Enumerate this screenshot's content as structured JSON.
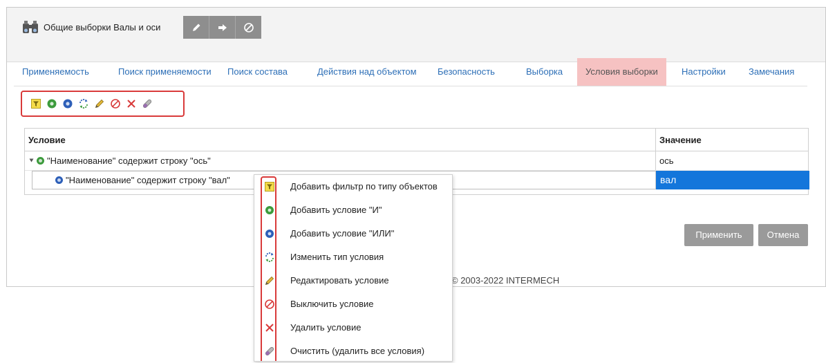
{
  "header": {
    "title": "Общие выборки Валы и оси",
    "title_icon": "binoculars-icon",
    "tools": [
      "pencil-icon",
      "arrow-right-icon",
      "cancel-icon"
    ]
  },
  "tabs": [
    {
      "label": "Применяемость"
    },
    {
      "label": "Поиск применяемости"
    },
    {
      "label": "Поиск состава"
    },
    {
      "label": "Действия над объектом"
    },
    {
      "label": "Безопасность"
    },
    {
      "label": "Выборка"
    },
    {
      "label": "Условия выборки",
      "active": true
    },
    {
      "label": "Настройки"
    },
    {
      "label": "Замечания"
    }
  ],
  "toolbar": {
    "icons": [
      "type-filter-icon",
      "and-condition-icon",
      "or-condition-icon",
      "change-type-icon",
      "edit-icon",
      "disable-icon",
      "delete-icon",
      "clear-icon"
    ]
  },
  "grid": {
    "columns": {
      "condition": "Условие",
      "value": "Значение"
    },
    "rows": [
      {
        "condition": "\"Наименование\" содержит строку \"ось\"",
        "value": "ось",
        "type": "and"
      },
      {
        "condition": "\"Наименование\" содержит строку \"вал\"",
        "value": "вал",
        "type": "or",
        "selected": true
      }
    ]
  },
  "buttons": {
    "apply": "Применить",
    "cancel": "Отмена"
  },
  "footer": {
    "copyright": "© 2003-2022 INTERMECH"
  },
  "context_menu": {
    "items": [
      {
        "label": "Добавить фильтр по типу объектов",
        "icon": "type-filter-icon"
      },
      {
        "label": "Добавить условие \"И\"",
        "icon": "and-condition-icon"
      },
      {
        "label": "Добавить условие \"ИЛИ\"",
        "icon": "or-condition-icon"
      },
      {
        "label": "Изменить тип условия",
        "icon": "change-type-icon"
      },
      {
        "label": "Редактировать условие",
        "icon": "edit-icon"
      },
      {
        "label": "Выключить условие",
        "icon": "disable-icon"
      },
      {
        "label": "Удалить условие",
        "icon": "delete-icon"
      },
      {
        "label": "Очистить (удалить все условия)",
        "icon": "clear-icon"
      }
    ]
  },
  "colors": {
    "accent_link": "#2d6fb7",
    "active_tab": "#f6c2c2",
    "selection": "#1476db",
    "highlight_border": "#d93a3a"
  }
}
